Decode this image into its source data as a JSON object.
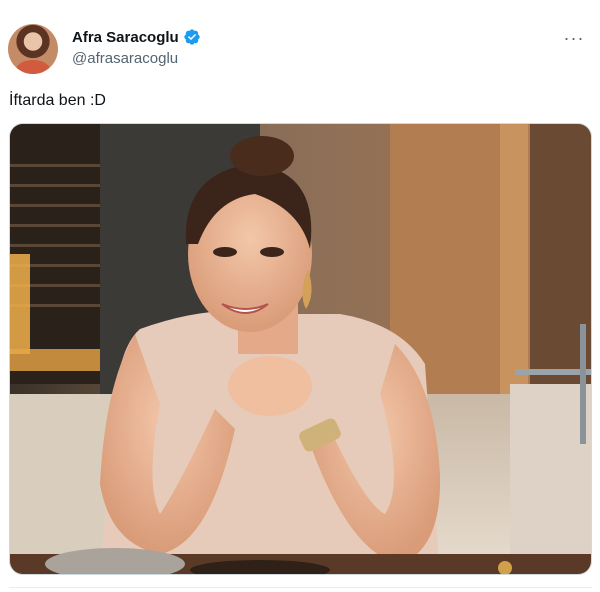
{
  "author": {
    "display_name": "Afra Saracoglu",
    "handle": "@afrasaracoglu",
    "verified": true,
    "avatar_icon": "avatar-photo"
  },
  "tweet": {
    "text": "İftarda ben :D",
    "media_alt": "Photo of a smiling woman seated at a dinner table"
  },
  "icons": {
    "more": "more-options-icon",
    "verified": "verified-badge-icon"
  },
  "colors": {
    "verified_blue": "#1d9bf0",
    "handle_gray": "#536471",
    "text_black": "#0f1419"
  }
}
